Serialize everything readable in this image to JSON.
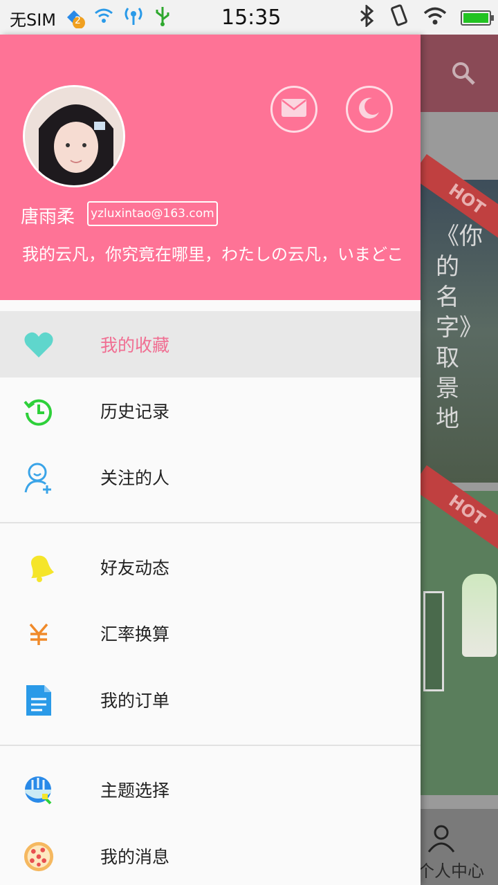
{
  "status_bar": {
    "carrier": "无SIM",
    "badge": "2",
    "time": "15:35"
  },
  "background_app": {
    "hot1": "HOT",
    "hot2": "HOT",
    "card_title": "《你的名字》取景地",
    "tab_label": "个人中心"
  },
  "drawer": {
    "username": "唐雨柔",
    "email": "yzluxintao@163.com",
    "signature": "我的云凡，你究竟在哪里，わたしの云凡，いまどこ",
    "groups": [
      [
        {
          "label": "我的收藏",
          "icon": "heart-icon",
          "active": true,
          "color": "#5fd6cc"
        },
        {
          "label": "历史记录",
          "icon": "history-icon",
          "color": "#2ed03a"
        },
        {
          "label": "关注的人",
          "icon": "follow-user-icon",
          "color": "#3aa4e8"
        }
      ],
      [
        {
          "label": "好友动态",
          "icon": "bell-icon",
          "color": "#f5e52a"
        },
        {
          "label": "汇率换算",
          "icon": "yen-icon",
          "color": "#f08a2a"
        },
        {
          "label": "我的订单",
          "icon": "document-icon",
          "color": "#2a9ae8"
        }
      ],
      [
        {
          "label": "主题选择",
          "icon": "theme-icon",
          "color": "#3a9ae8"
        },
        {
          "label": "我的消息",
          "icon": "pizza-icon",
          "color": "#f0a050"
        }
      ]
    ]
  }
}
